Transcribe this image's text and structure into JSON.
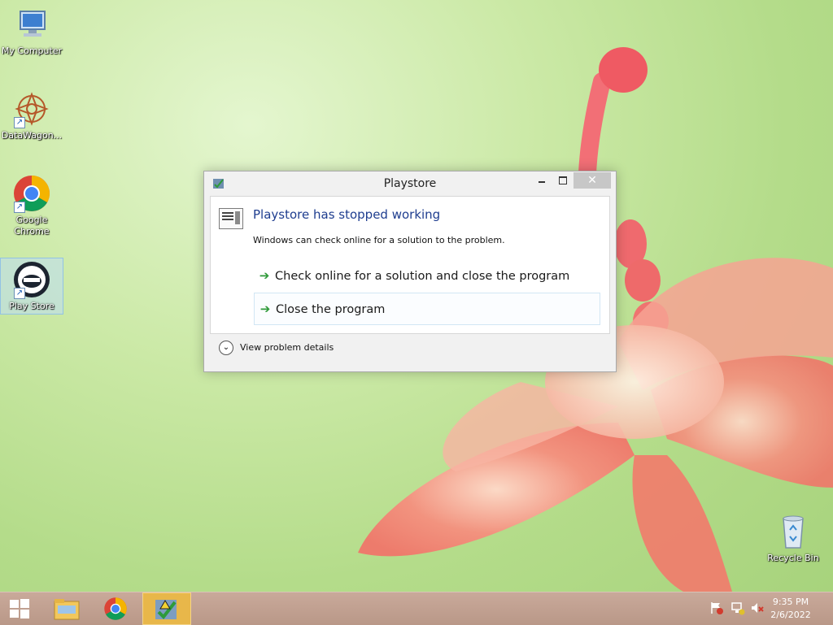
{
  "desktop": {
    "icons": [
      {
        "label": "My Computer"
      },
      {
        "label": "DataWagon..."
      },
      {
        "label": "Google Chrome"
      },
      {
        "label": "Play Store"
      },
      {
        "label": "Recycle Bin"
      }
    ]
  },
  "dialog": {
    "title": "Playstore",
    "heading": "Playstore has stopped working",
    "message": "Windows can check online for a solution to the problem.",
    "option_check_online": "Check online for a solution and close the program",
    "option_close": "Close the program",
    "details_label": "View problem details",
    "close_glyph": "✕"
  },
  "taskbar": {
    "time": "9:35 PM",
    "date": "2/6/2022"
  },
  "colors": {
    "dialog_heading": "#1e3d8f",
    "command_arrow": "#2f9a3a",
    "taskbar": "#c2a192",
    "active_taskbar_item": "#e8b74a"
  }
}
